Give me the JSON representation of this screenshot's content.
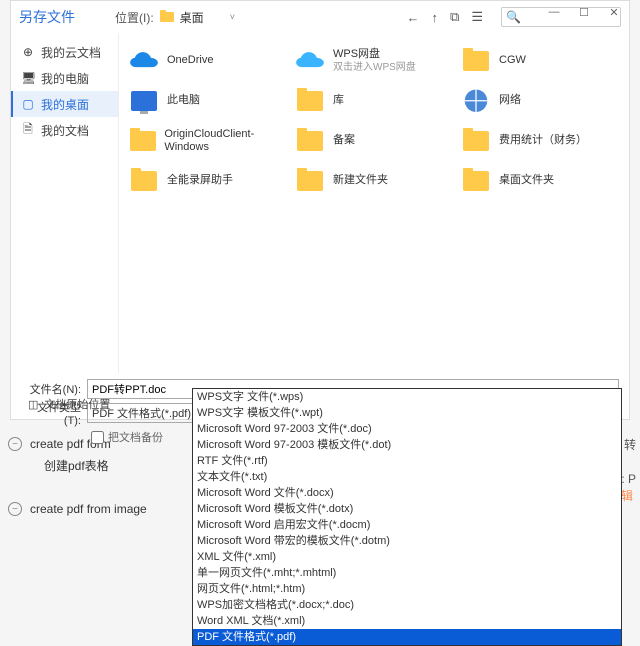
{
  "window": {
    "title": "另存文件",
    "min": "—",
    "max": "☐",
    "close": "✕"
  },
  "toolbar": {
    "loc_label": "位置(I):",
    "loc_value": "桌面",
    "nav": {
      "back": "←",
      "up": "↑",
      "new": "⧉",
      "view": "☰"
    },
    "search_icon": "🔍"
  },
  "sidebar": {
    "items": [
      {
        "icon": "⊕",
        "label": "我的云文档"
      },
      {
        "icon": "🖥",
        "label": "我的电脑"
      },
      {
        "icon": "▢",
        "label": "我的桌面"
      },
      {
        "icon": "🗎",
        "label": "我的文档"
      }
    ]
  },
  "grid": {
    "items": [
      {
        "type": "onedrive",
        "label": "OneDrive"
      },
      {
        "type": "wps",
        "label": "WPS网盘",
        "sub": "双击进入WPS网盘"
      },
      {
        "type": "folder",
        "label": "CGW"
      },
      {
        "type": "pc",
        "label": "此电脑"
      },
      {
        "type": "folder",
        "label": "库"
      },
      {
        "type": "net",
        "label": "网络"
      },
      {
        "type": "folder",
        "label": "OriginCloudClient-Windows"
      },
      {
        "type": "folder",
        "label": "备案"
      },
      {
        "type": "folder",
        "label": "费用统计（财务）"
      },
      {
        "type": "folder",
        "label": "全能录屏助手"
      },
      {
        "type": "folder",
        "label": "新建文件夹"
      },
      {
        "type": "folder",
        "label": "桌面文件夹"
      }
    ]
  },
  "fields": {
    "name_label": "文件名(N):",
    "name_value": "PDF转PPT.doc",
    "type_label": "文件类型(T):",
    "type_value": "PDF 文件格式(*.pdf)",
    "chk_label": "把文档备份"
  },
  "dropdown": {
    "options": [
      "WPS文字 文件(*.wps)",
      "WPS文字 模板文件(*.wpt)",
      "Microsoft Word 97-2003 文件(*.doc)",
      "Microsoft Word 97-2003 模板文件(*.dot)",
      "RTF 文件(*.rtf)",
      "文本文件(*.txt)",
      "Microsoft Word 文件(*.docx)",
      "Microsoft Word 模板文件(*.dotx)",
      "Microsoft Word 启用宏文件(*.docm)",
      "Microsoft Word 带宏的模板文件(*.dotm)",
      "XML 文件(*.xml)",
      "单一网页文件(*.mht;*.mhtml)",
      "网页文件(*.html;*.htm)",
      "WPS加密文档格式(*.docx;*.doc)",
      "Word XML 文档(*.xml)",
      "PDF 文件格式(*.pdf)"
    ],
    "selected_index": 15
  },
  "bottom_side": {
    "icon": "◫",
    "label": "文档原始位置"
  },
  "background": {
    "item1": "create pdf form",
    "item1_sub": "创建pdf表格",
    "item2": "create pdf from image",
    "corner1": "DF 转",
    "corner2": "具: P",
    "stamp": "出@金闪PDF编辑"
  }
}
